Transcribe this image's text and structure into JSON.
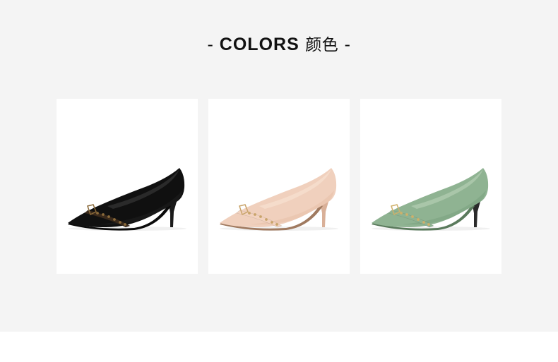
{
  "header": {
    "dash_left": "-",
    "title_en": "COLORS",
    "title_cn": "颜色",
    "dash_right": "-"
  },
  "products": [
    {
      "color": "#101010",
      "upper_shade": "#1c1c1c",
      "inner": "#2a2a2a",
      "strap": "#3a2a1c",
      "stud": "#8a6a3a",
      "heel": "#1a1a1a",
      "sole": "#0a0a0a"
    },
    {
      "color": "#f0d0bd",
      "upper_shade": "#e8c3ad",
      "inner": "#f5dccb",
      "strap": "#f3d3c0",
      "stud": "#c9a46a",
      "heel": "#d9b098",
      "sole": "#a07a60"
    },
    {
      "color": "#8fb392",
      "upper_shade": "#7ea583",
      "inner": "#a9c6a9",
      "strap": "#8fb392",
      "stud": "#cfb06a",
      "heel": "#2a2a2a",
      "sole": "#5a7a5c"
    }
  ]
}
